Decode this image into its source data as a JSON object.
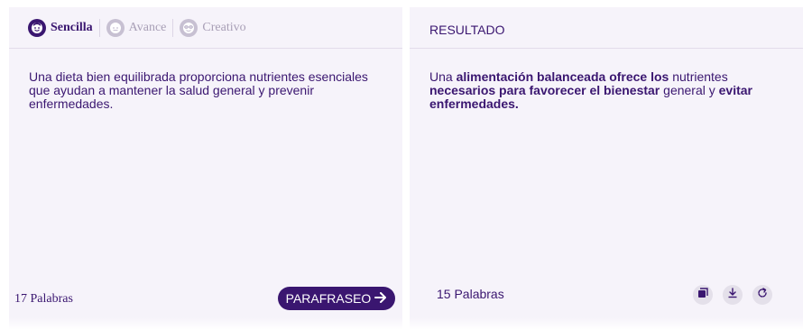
{
  "tabs": [
    {
      "label": "Sencilla",
      "icon": "happy-face-icon",
      "active": true
    },
    {
      "label": "Avance",
      "icon": "face-icon",
      "active": false
    },
    {
      "label": "Creativo",
      "icon": "creative-face-icon",
      "active": false
    }
  ],
  "input": {
    "text": "Una dieta bien equilibrada proporciona nutrientes esenciales que ayudan a mantener la salud general y prevenir enfermedades.",
    "word_count": "17 Palabras"
  },
  "paraphrase_button": {
    "label": "PARAFRASEO",
    "icon": "arrow-right-icon"
  },
  "result": {
    "header": "RESULTADO",
    "segments": [
      {
        "text": "Una ",
        "bold": false
      },
      {
        "text": "alimentación balanceada ofrece los",
        "bold": true
      },
      {
        "text": " nutrientes ",
        "bold": false
      },
      {
        "text": "necesarios para favorecer el bienestar",
        "bold": true
      },
      {
        "text": " general y ",
        "bold": false
      },
      {
        "text": "evitar enfermedades.",
        "bold": true
      }
    ],
    "word_count": "15 Palabras"
  },
  "actions": [
    {
      "name": "copy-icon"
    },
    {
      "name": "download-icon"
    },
    {
      "name": "refresh-icon"
    }
  ],
  "colors": {
    "accent": "#3a1670",
    "panel": "#f6f3fa",
    "muted": "#a89fb6"
  }
}
